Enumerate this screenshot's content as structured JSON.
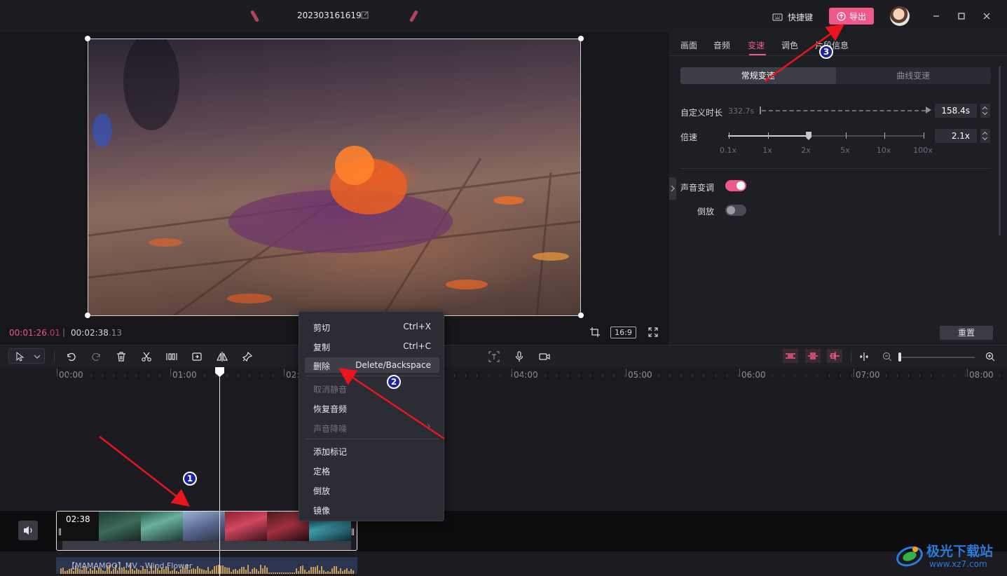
{
  "titlebar": {
    "project_title": "202303161619",
    "shortcut_label": "快捷键",
    "export_label": "导出"
  },
  "player": {
    "current_time": "00:01:26",
    "current_frames": ".01",
    "total_time": "00:02:38",
    "total_frames": ".13",
    "ratio_label": "16:9"
  },
  "panel": {
    "tabs": [
      {
        "label": "画面"
      },
      {
        "label": "音频"
      },
      {
        "label": "变速"
      },
      {
        "label": "调色"
      },
      {
        "label": "片段信息"
      }
    ],
    "active_tab": "变速",
    "segments": [
      {
        "label": "常规变速"
      },
      {
        "label": "曲线变速"
      }
    ],
    "custom_duration_label": "自定义时长",
    "original_duration": "332.7s",
    "custom_duration_value": "158.4s",
    "speed_label": "倍速",
    "speed_value": "2.1x",
    "speed_ticks": [
      "0.1x",
      "1x",
      "2x",
      "5x",
      "10x",
      "100x"
    ],
    "speed_position_fraction": 0.41,
    "voice_pitch_label": "声音变调",
    "voice_pitch_on": true,
    "reverse_label": "倒放",
    "reverse_on": false,
    "reset_label": "重置"
  },
  "timeline": {
    "ruler_labels": [
      "00:00",
      "01:00",
      "02:",
      "04:00",
      "05:00",
      "06:00",
      "07:00",
      "08:00"
    ],
    "clip_duration": "02:38",
    "audio_label": "【MAMAMOO】MV - Wind Flower",
    "colors": {
      "accent": "#f0588a",
      "track_bg": "#0d0d10",
      "audio": "#2b3550"
    }
  },
  "context_menu": {
    "items": [
      {
        "label": "剪切",
        "shortcut": "Ctrl+X",
        "disabled": false
      },
      {
        "label": "复制",
        "shortcut": "Ctrl+C",
        "disabled": false
      },
      {
        "label": "删除",
        "shortcut": "Delete/Backspace",
        "disabled": false,
        "highlighted": true
      },
      {
        "label": "取消静音",
        "shortcut": "",
        "disabled": true
      },
      {
        "label": "恢复音频",
        "shortcut": "",
        "disabled": false
      },
      {
        "label": "声音降噪",
        "shortcut": "",
        "disabled": true,
        "submenu": true
      },
      {
        "label": "添加标记",
        "shortcut": "",
        "disabled": false
      },
      {
        "label": "定格",
        "shortcut": "",
        "disabled": false
      },
      {
        "label": "倒放",
        "shortcut": "",
        "disabled": false
      },
      {
        "label": "镜像",
        "shortcut": "",
        "disabled": false
      }
    ]
  },
  "annotations": {
    "badges": [
      "1",
      "2",
      "3"
    ],
    "arrow_color": "#e8161c"
  },
  "watermark": {
    "text": "极光下载站",
    "url": "www.xz7.com"
  }
}
